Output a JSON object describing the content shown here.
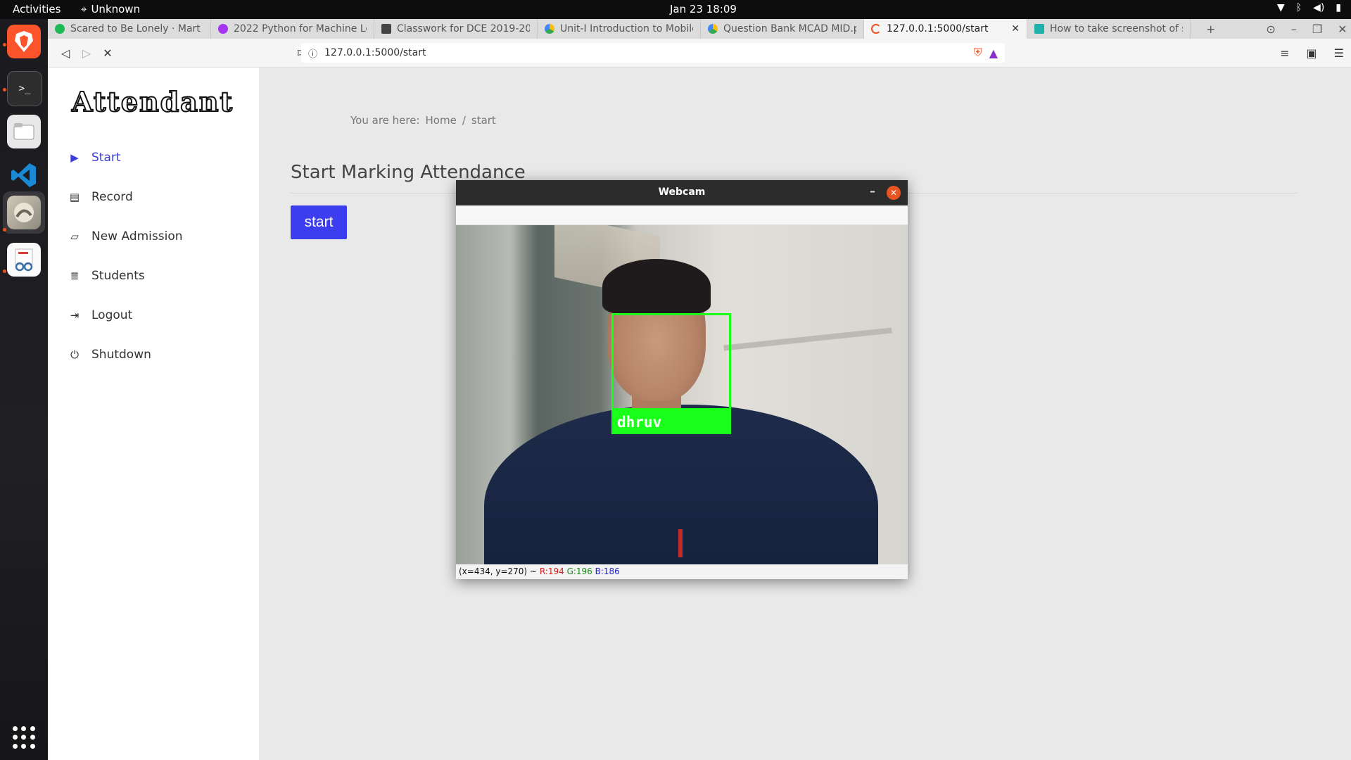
{
  "topbar": {
    "activities": "Activities",
    "network_label": "Unknown",
    "clock": "Jan 23  18:09"
  },
  "browser": {
    "tabs": [
      {
        "label": "Scared to Be Lonely · Mart",
        "favicon_color": "#1db954"
      },
      {
        "label": "2022 Python for Machine Lea",
        "favicon_color": "#a435f0"
      },
      {
        "label": "Classwork for DCE 2019-2022",
        "favicon_color": "#444444"
      },
      {
        "label": "Unit-I Introduction to Mobile",
        "favicon_color": "#fbbc04"
      },
      {
        "label": "Question Bank MCAD MID.p",
        "favicon_color": "#34a853"
      },
      {
        "label": "127.0.0.1:5000/start",
        "favicon_color": "#e95420"
      },
      {
        "label": "How to take screenshot of s",
        "favicon_color": "#20b2aa"
      }
    ],
    "new_tab": "+",
    "url": "127.0.0.1:5000/start"
  },
  "app": {
    "logo": "Attendant",
    "menu": [
      {
        "label": "Start",
        "icon": "play-icon"
      },
      {
        "label": "Record",
        "icon": "book-icon"
      },
      {
        "label": "New Admission",
        "icon": "folder-open-icon"
      },
      {
        "label": "Students",
        "icon": "database-icon"
      },
      {
        "label": "Logout",
        "icon": "sign-out-icon"
      },
      {
        "label": "Shutdown",
        "icon": "power-icon"
      }
    ],
    "breadcrumb": {
      "prefix": "You are here:",
      "home": "Home",
      "separator": "/",
      "current": "start"
    },
    "page_title": "Start Marking Attendance",
    "start_button": "start"
  },
  "webcam": {
    "title": "Webcam",
    "minimize": "–",
    "close": "✕",
    "detected_name": "dhruv",
    "status": {
      "coords": "(x=434, y=270) ~",
      "r": "R:194",
      "g": "G:196",
      "b": "B:186"
    }
  }
}
